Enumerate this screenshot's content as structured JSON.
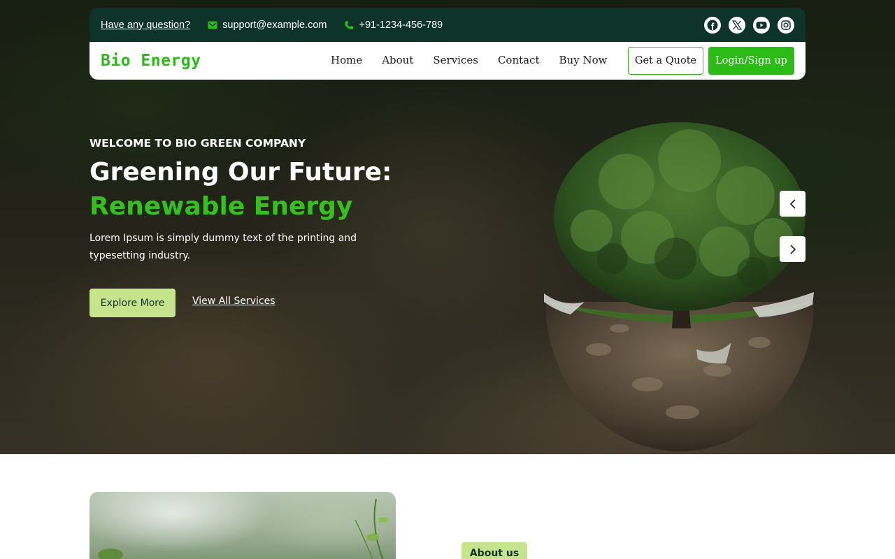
{
  "topbar": {
    "question_link": "Have any question?",
    "email": "support@example.com",
    "phone": "+91-1234-456-789",
    "email_icon": "envelope-icon",
    "phone_icon": "phone-icon",
    "socials": [
      "facebook-icon",
      "x-icon",
      "youtube-icon",
      "instagram-icon"
    ]
  },
  "navbar": {
    "logo": "Bio Energy",
    "links": [
      "Home",
      "About",
      "Services",
      "Contact",
      "Buy Now"
    ],
    "quote_button": "Get a Quote",
    "login_button": "Login/Sign up"
  },
  "hero": {
    "eyebrow": "WELCOME TO BIO GREEN COMPANY",
    "headline_line1": "Greening Our Future:",
    "headline_line2": "Renewable Energy",
    "description": "Lorem Ipsum is simply dummy text of the printing and typesetting industry.",
    "primary_button": "Explore More",
    "secondary_link": "View All Services",
    "prev_icon": "chevron-left-icon",
    "next_icon": "chevron-right-icon"
  },
  "about": {
    "badge": "About us"
  },
  "colors": {
    "brand_green": "#2bbd16",
    "accent_green": "#33c21a",
    "topbar_bg": "#0e3329",
    "pale_green": "#c6e48b"
  }
}
